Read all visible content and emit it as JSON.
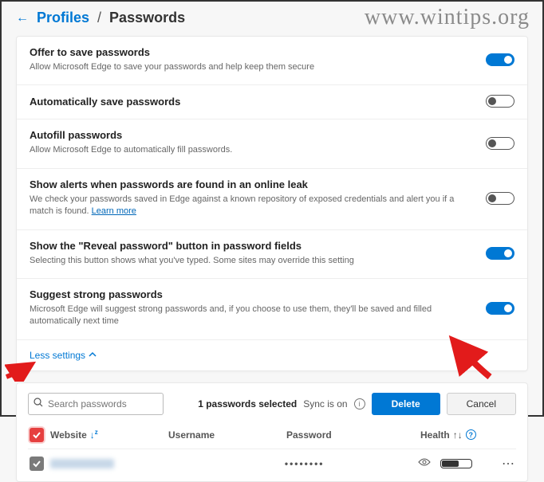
{
  "watermark": "www.wintips.org",
  "breadcrumb": {
    "back_icon": "←",
    "profiles": "Profiles",
    "separator": "/",
    "passwords": "Passwords"
  },
  "settings": [
    {
      "title": "Offer to save passwords",
      "desc": "Allow Microsoft Edge to save your passwords and help keep them secure",
      "on": true
    },
    {
      "title": "Automatically save passwords",
      "desc": "",
      "on": false
    },
    {
      "title": "Autofill passwords",
      "desc": "Allow Microsoft Edge to automatically fill passwords.",
      "on": false
    },
    {
      "title": "Show alerts when passwords are found in an online leak",
      "desc": "We check your passwords saved in Edge against a known repository of exposed credentials and alert you if a match is found.",
      "learn_more": "Learn more",
      "on": false
    },
    {
      "title": "Show the \"Reveal password\" button in password fields",
      "desc": "Selecting this button shows what you've typed. Some sites may override this setting",
      "on": true
    },
    {
      "title": "Suggest strong passwords",
      "desc": "Microsoft Edge will suggest strong passwords and, if you choose to use them, they'll be saved and filled automatically next time",
      "on": true
    }
  ],
  "less_settings": "Less settings",
  "toolbar": {
    "search_placeholder": "Search passwords",
    "selected_text": "1 passwords selected",
    "sync_text": "Sync is on",
    "delete_label": "Delete",
    "cancel_label": "Cancel"
  },
  "columns": {
    "website": "Website",
    "username": "Username",
    "password": "Password",
    "health": "Health"
  },
  "rows": [
    {
      "website_blur": true,
      "username_blur": true,
      "password_mask": "••••••••",
      "checked": true
    }
  ]
}
